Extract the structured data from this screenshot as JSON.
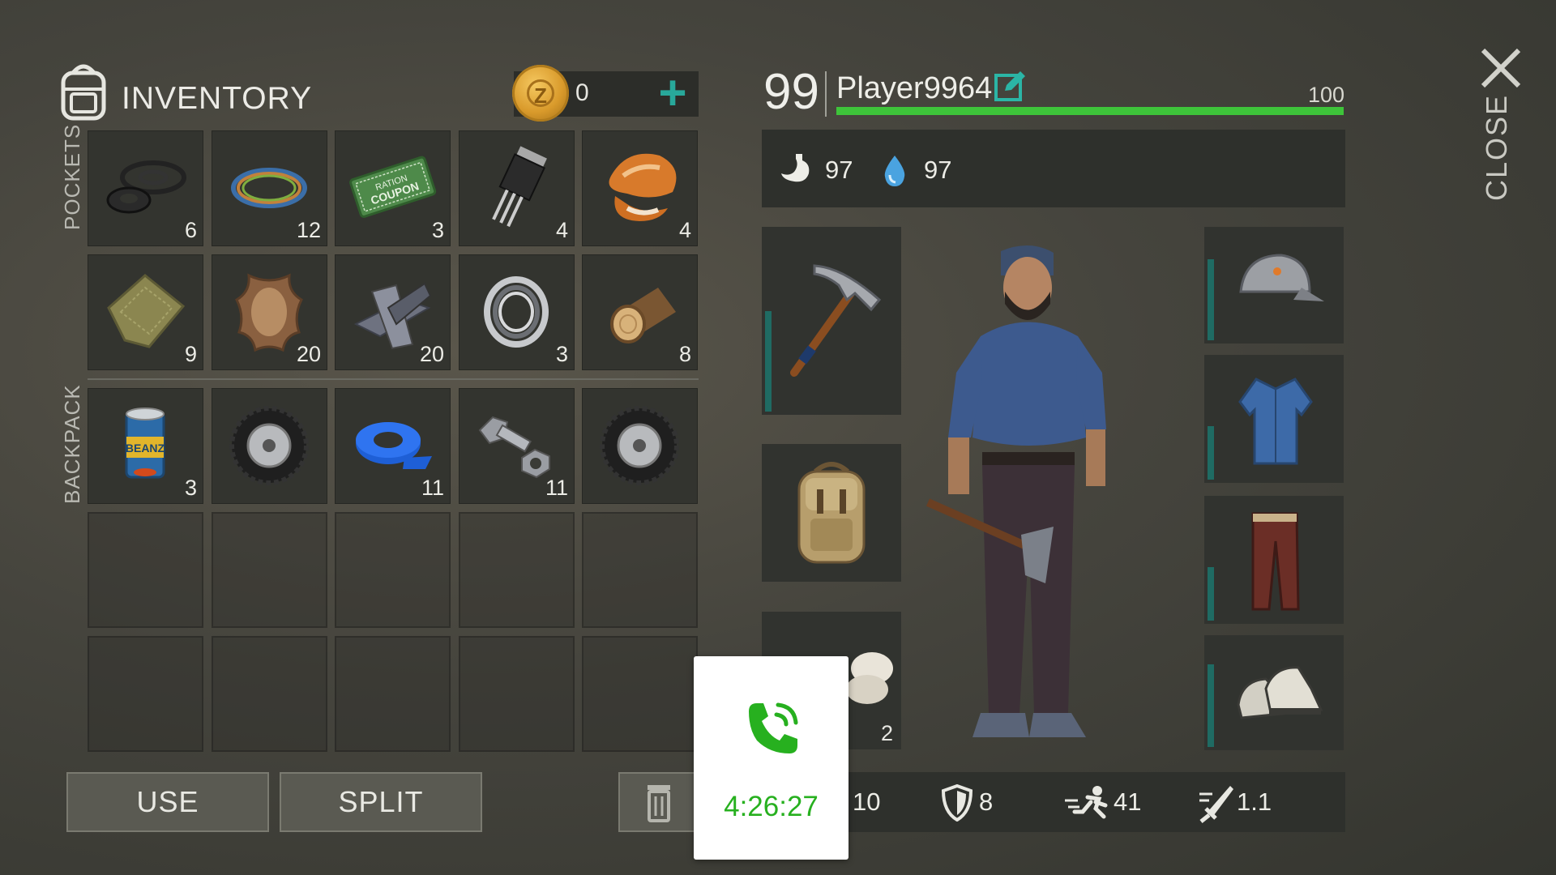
{
  "inventory": {
    "title": "INVENTORY",
    "coins": "0",
    "add_coins_symbol": "+",
    "pockets_label": "POCKETS",
    "backpack_label": "BACKPACK",
    "pockets": [
      {
        "item": "rubber-seals",
        "qty": "6"
      },
      {
        "item": "wire-coil",
        "qty": "12"
      },
      {
        "item": "ration-coupon",
        "qty": "3",
        "text1": "RATION",
        "text2": "COUPON"
      },
      {
        "item": "transistor",
        "qty": "4"
      },
      {
        "item": "fox-fur",
        "qty": "4"
      },
      {
        "item": "cloth",
        "qty": "9"
      },
      {
        "item": "leather-hide",
        "qty": "20"
      },
      {
        "item": "scrap-metal",
        "qty": "20"
      },
      {
        "item": "bearing",
        "qty": "3"
      },
      {
        "item": "log",
        "qty": "8"
      }
    ],
    "backpack": [
      {
        "item": "beans-can",
        "qty": "3",
        "text1": "BEANZ"
      },
      {
        "item": "tire",
        "qty": ""
      },
      {
        "item": "tape",
        "qty": "11"
      },
      {
        "item": "bolt-nut",
        "qty": "11"
      },
      {
        "item": "tire",
        "qty": ""
      }
    ],
    "buttons": {
      "use": "USE",
      "split": "SPLIT"
    }
  },
  "player": {
    "level": "99",
    "name": "Player9964",
    "xp_max": "100",
    "xp_fraction": 1.0,
    "food": "97",
    "water": "97",
    "bandage_qty": "2",
    "stats": {
      "attack": "10",
      "armor": "8",
      "speed": "41",
      "weapon": "1.1"
    }
  },
  "close_label": "CLOSE",
  "call_overlay": {
    "time": "4:26:27"
  },
  "colors": {
    "accent": "#28a89a",
    "xp": "#3ec43a",
    "call": "#27b01f"
  }
}
